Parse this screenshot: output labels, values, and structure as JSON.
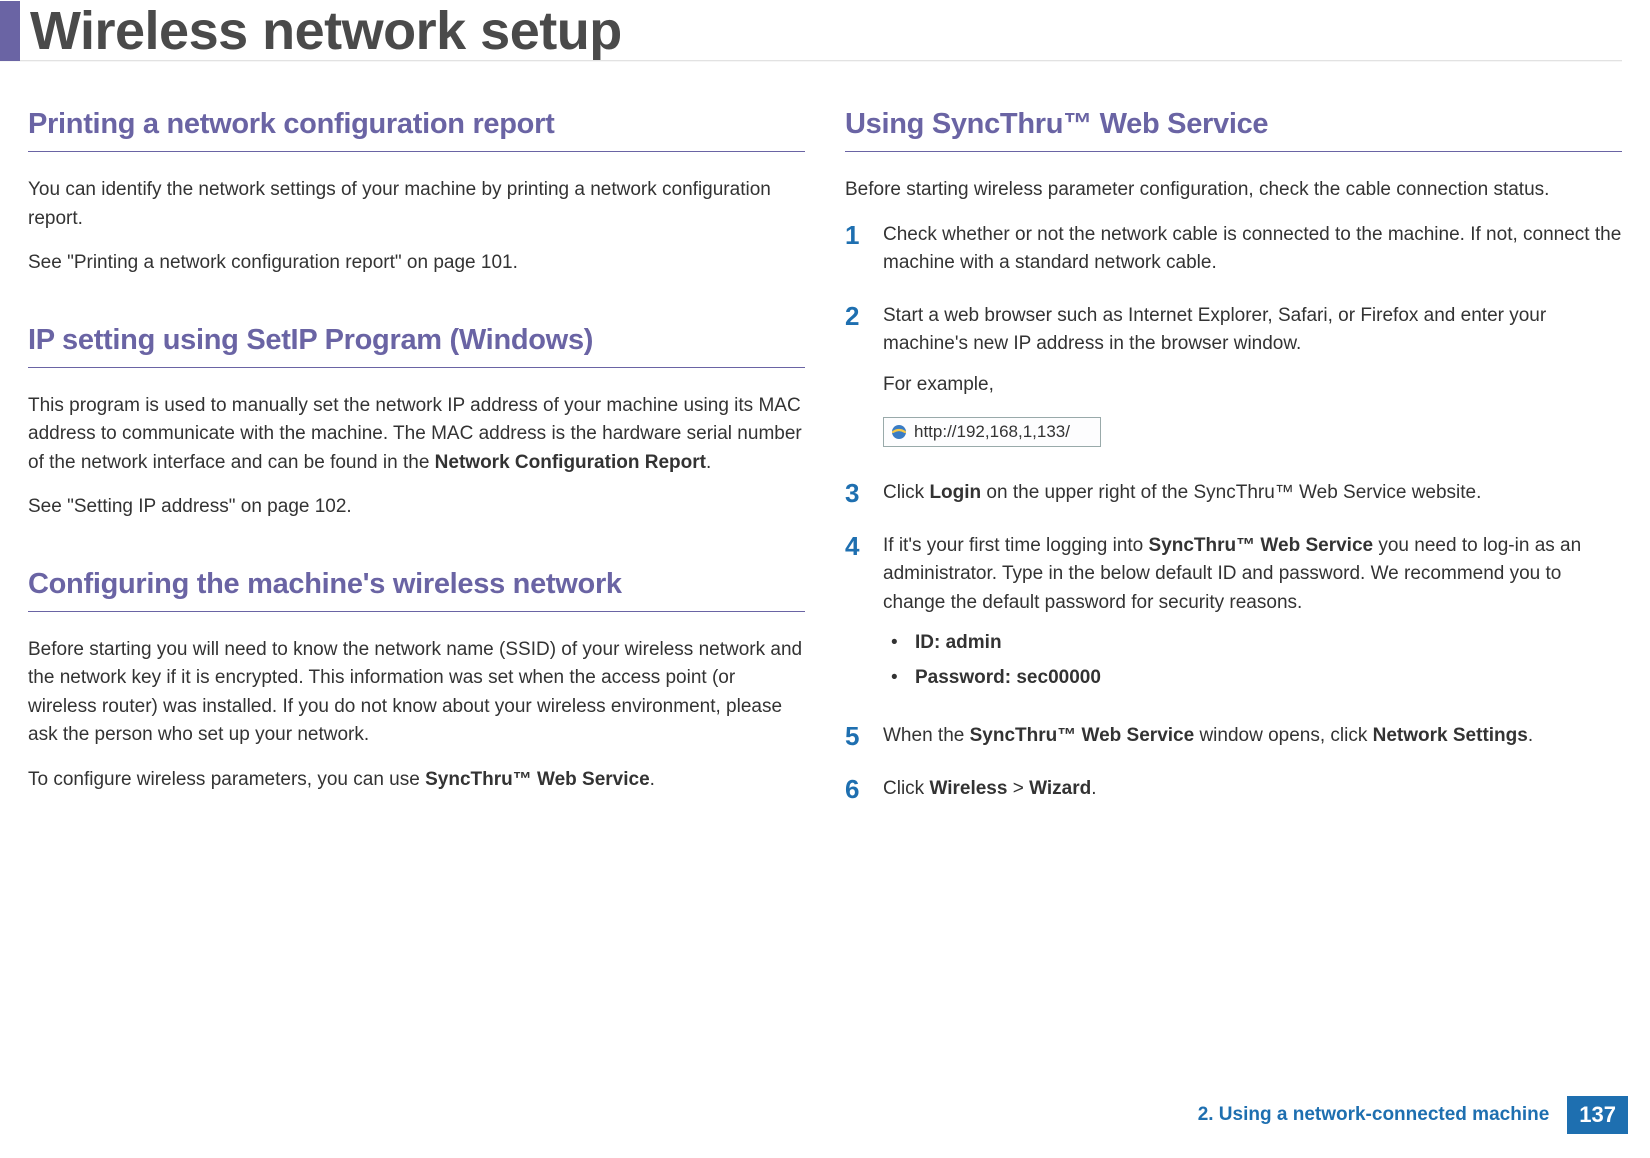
{
  "page": {
    "title": "Wireless network setup"
  },
  "left": {
    "section1": {
      "heading": "Printing a network configuration report",
      "p1": "You can identify the network settings of your machine by printing a network configuration report.",
      "p2": "See \"Printing a network configuration report\" on page 101."
    },
    "section2": {
      "heading": "IP setting using SetIP Program (Windows)",
      "p1_pre": "This program is used to manually set the network IP address of your machine using its MAC address to communicate with the machine. The MAC address is the hardware serial number of the network interface and can be found in the ",
      "p1_bold": "Network Configuration Report",
      "p1_post": ".",
      "p2": "See \"Setting IP address\" on page 102."
    },
    "section3": {
      "heading": "Configuring the machine's wireless network",
      "p1": "Before starting you will need to know the network name (SSID) of your wireless network and the network key if it is encrypted. This information was set when the access point (or wireless router) was installed. If you do not know about your wireless environment, please ask the person who set up your network.",
      "p2_pre": "To configure wireless parameters, you can use ",
      "p2_bold": "SyncThru™ Web Service",
      "p2_post": "."
    }
  },
  "right": {
    "heading": "Using SyncThru™ Web Service",
    "intro": "Before starting wireless parameter configuration, check the cable connection status.",
    "steps": {
      "s1": {
        "num": "1",
        "text": "Check whether or not the network cable is connected to the machine. If not, connect the machine with a standard network cable."
      },
      "s2": {
        "num": "2",
        "text": "Start a web browser such as Internet Explorer, Safari, or Firefox and enter your machine's new IP address in the browser window.",
        "example_label": "For example,",
        "url": "http://192,168,1,133/"
      },
      "s3": {
        "num": "3",
        "pre": "Click ",
        "bold": "Login",
        "post": " on the upper right of the SyncThru™ Web Service website."
      },
      "s4": {
        "num": "4",
        "p1_pre": "If it's your first time logging into ",
        "p1_bold": "SyncThru™ Web Service",
        "p1_post": " you need to log-in as an administrator. Type in the below default ID and password. We recommend you to change the default password for security reasons.",
        "bullet1_label": "ID: admin",
        "bullet2_label": "Password: sec00000"
      },
      "s5": {
        "num": "5",
        "pre": "When the ",
        "bold1": "SyncThru™ Web Service",
        "mid": " window opens, click ",
        "bold2": "Network Settings",
        "post": "."
      },
      "s6": {
        "num": "6",
        "pre": "Click ",
        "bold1": "Wireless",
        "mid": " > ",
        "bold2": "Wizard",
        "post": "."
      }
    }
  },
  "footer": {
    "text": "2.  Using a network-connected machine",
    "page_number": "137"
  }
}
